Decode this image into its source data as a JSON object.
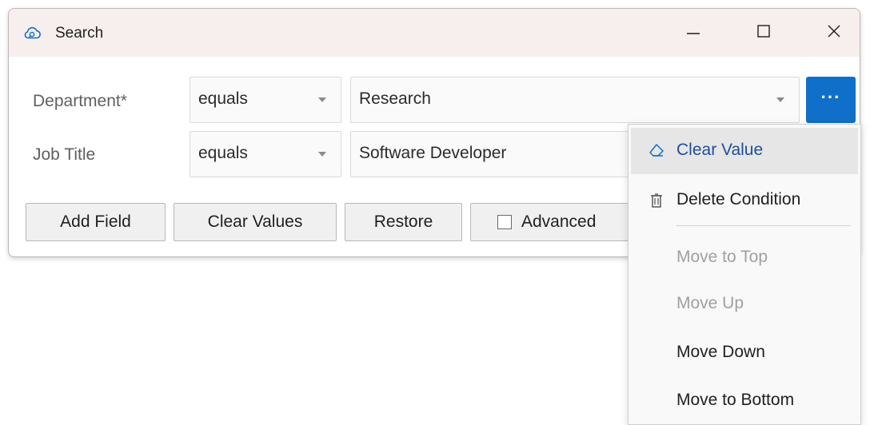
{
  "window": {
    "title": "Search",
    "icon": "cloud-search-icon"
  },
  "window_controls": {
    "minimize": "minimize-icon",
    "maximize": "maximize-icon",
    "close": "close-icon"
  },
  "conditions": [
    {
      "label": "Department*",
      "operator": "equals",
      "value": "Research"
    },
    {
      "label": "Job Title",
      "operator": "equals",
      "value": "Software Developer"
    }
  ],
  "more_button": {
    "label": "···",
    "color": "#1070c9"
  },
  "buttons": {
    "add_field": "Add Field",
    "clear_values": "Clear Values",
    "restore": "Restore",
    "advanced": "Advanced"
  },
  "advanced_checked": false,
  "menu": {
    "items": [
      {
        "label": "Clear Value",
        "icon": "eraser-icon",
        "enabled": true,
        "highlighted": true
      },
      {
        "label": "Delete Condition",
        "icon": "trash-icon",
        "enabled": true
      },
      {
        "label": "Move to Top",
        "enabled": false
      },
      {
        "label": "Move Up",
        "enabled": false
      },
      {
        "label": "Move Down",
        "enabled": true
      },
      {
        "label": "Move to Bottom",
        "enabled": true
      }
    ]
  },
  "colors": {
    "accent": "#1070c9",
    "title_bar": "#f7eeee",
    "disabled_text": "#a0a0a0",
    "highlight_text": "#1f4e9c"
  }
}
